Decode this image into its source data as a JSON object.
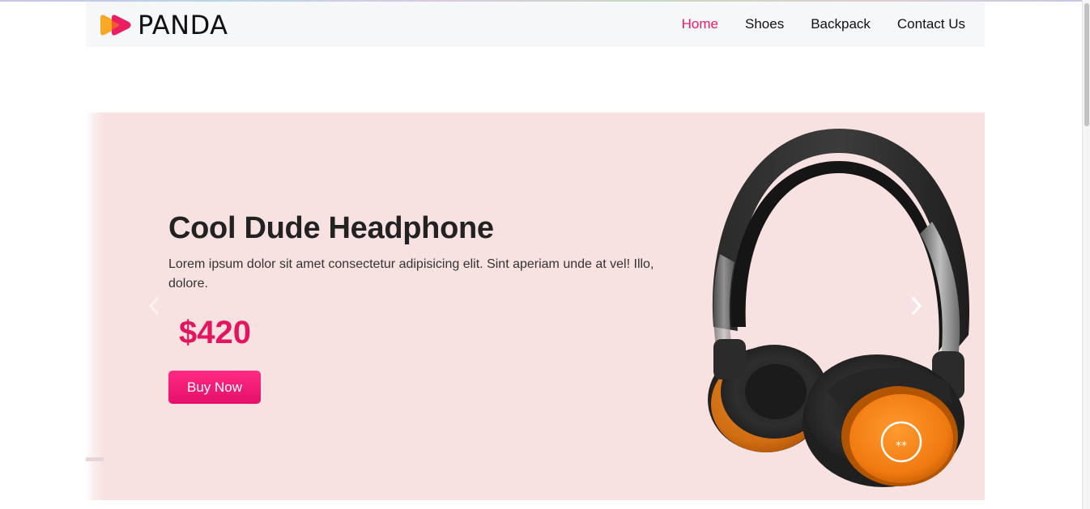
{
  "brand": {
    "name": "PANDA",
    "logo_icon": "panda-play-logo-icon",
    "logo_colors": [
      "#f9a825",
      "#e91e63"
    ]
  },
  "nav": {
    "items": [
      {
        "label": "Home",
        "active": true
      },
      {
        "label": "Shoes",
        "active": false
      },
      {
        "label": "Backpack",
        "active": false
      },
      {
        "label": "Contact Us",
        "active": false
      }
    ],
    "active_color": "#e91e63"
  },
  "hero": {
    "title": "Cool Dude Headphone",
    "description": "Lorem ipsum dolor sit amet consectetur adipisicing elit. Sint aperiam unde at vel! Illo, dolore.",
    "price": "$420",
    "cta_label": "Buy Now",
    "background_color": "#f8e2e1",
    "accent_color": "#e4145f",
    "image": "headphone-image",
    "prev_icon": "chevron-left-icon",
    "next_icon": "chevron-right-icon"
  }
}
